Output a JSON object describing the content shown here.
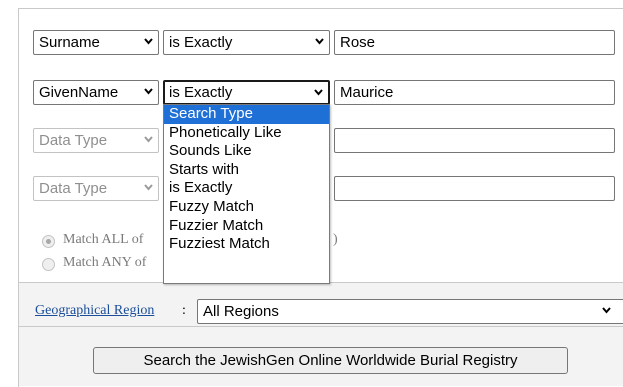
{
  "rows": [
    {
      "field": "Surname",
      "type": "is Exactly",
      "value": "Rose"
    },
    {
      "field": "GivenName",
      "type": "is Exactly",
      "value": "Maurice"
    },
    {
      "field": "Data Type",
      "value": ""
    },
    {
      "field": "Data Type",
      "value": ""
    }
  ],
  "radios": {
    "match_all": "Match ALL of",
    "match_any": "Match ANY of",
    "partial_paren": ")"
  },
  "dropdown": {
    "options": [
      "Search Type",
      "Phonetically Like",
      "Sounds Like",
      "Starts with",
      "is Exactly",
      "Fuzzy Match",
      "Fuzzier Match",
      "Fuzziest Match"
    ],
    "highlighted": "Search Type"
  },
  "region": {
    "label": "Geographical Region",
    "colon": ":",
    "value": "All Regions"
  },
  "search_button": "Search the JewishGen Online Worldwide Burial Registry",
  "colors": {
    "highlight": "#1e6fd6",
    "link": "#1b4d99"
  }
}
